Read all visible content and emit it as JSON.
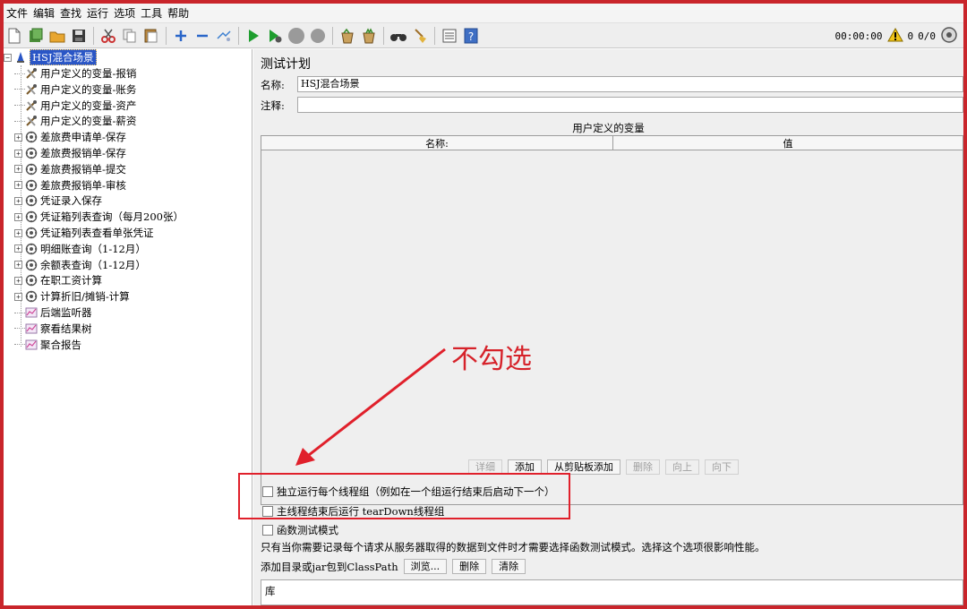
{
  "menu": [
    "文件",
    "编辑",
    "查找",
    "运行",
    "选项",
    "工具",
    "帮助"
  ],
  "toolbar": {
    "timer": "00:00:00",
    "warning_count": "0",
    "thread_count": "0/0"
  },
  "tree": {
    "root": "HSJ混合场景",
    "items": [
      {
        "label": "用户定义的变量-报销",
        "type": "config"
      },
      {
        "label": "用户定义的变量-账务",
        "type": "config"
      },
      {
        "label": "用户定义的变量-资产",
        "type": "config"
      },
      {
        "label": "用户定义的变量-薪资",
        "type": "config"
      },
      {
        "label": "差旅费申请单-保存",
        "type": "thread"
      },
      {
        "label": "差旅费报销单-保存",
        "type": "thread"
      },
      {
        "label": "差旅费报销单-提交",
        "type": "thread"
      },
      {
        "label": "差旅费报销单-审核",
        "type": "thread"
      },
      {
        "label": "凭证录入保存",
        "type": "thread"
      },
      {
        "label": "凭证箱列表查询（每月200张）",
        "type": "thread"
      },
      {
        "label": "凭证箱列表查看单张凭证",
        "type": "thread"
      },
      {
        "label": "明细账查询（1-12月）",
        "type": "thread"
      },
      {
        "label": "余额表查询（1-12月）",
        "type": "thread"
      },
      {
        "label": "在职工资计算",
        "type": "thread"
      },
      {
        "label": "计算折旧/摊销-计算",
        "type": "thread"
      },
      {
        "label": "后端监听器",
        "type": "listener"
      },
      {
        "label": "察看结果树",
        "type": "listener"
      },
      {
        "label": "聚合报告",
        "type": "listener"
      }
    ]
  },
  "panel": {
    "title": "测试计划",
    "name_label": "名称:",
    "name_value": "HSJ混合场景",
    "comment_label": "注释:",
    "comment_value": "",
    "vars_title": "用户定义的变量",
    "col_name": "名称:",
    "col_value": "值",
    "buttons": {
      "detail": "详细",
      "add": "添加",
      "add_clipboard": "从剪贴板添加",
      "delete": "删除",
      "up": "向上",
      "down": "向下"
    },
    "cb_serial": "独立运行每个线程组（例如在一个组运行结束后启动下一个）",
    "cb_teardown": "主线程结束后运行 tearDown线程组",
    "cb_functional": "函数测试模式",
    "note": "只有当你需要记录每个请求从服务器取得的数据到文件时才需要选择函数测试模式。选择这个选项很影响性能。",
    "classpath_label": "添加目录或jar包到ClassPath",
    "browse": "浏览...",
    "cp_delete": "删除",
    "cp_clear": "清除",
    "lib_label": "库"
  },
  "annotation": {
    "text": "不勾选",
    "color": "#d6222a"
  }
}
